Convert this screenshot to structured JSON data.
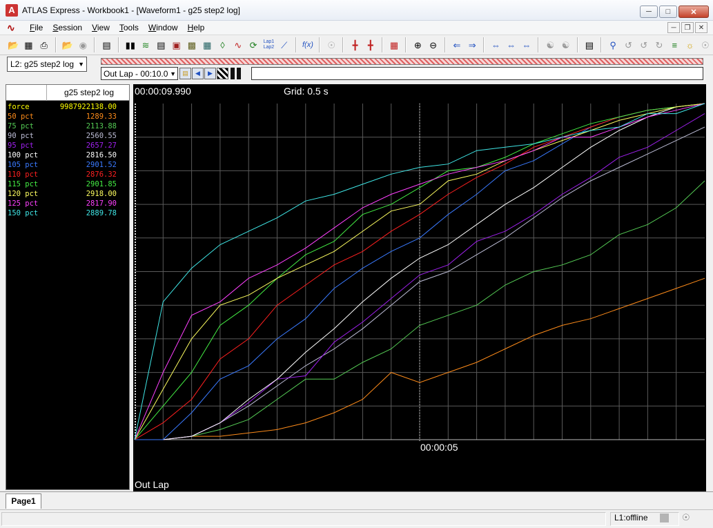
{
  "window": {
    "title": "ATLAS Express - Workbook1 - [Waveform1 - g25 step2 log]",
    "logo_letter": "A"
  },
  "menu": {
    "items": [
      "File",
      "Session",
      "View",
      "Tools",
      "Window",
      "Help"
    ]
  },
  "toolbar": {
    "lap_label": "Lap1 Lap2",
    "fx_label": "f(x)"
  },
  "session": {
    "selected": "L2: g25 step2 log"
  },
  "lap": {
    "selected": "Out Lap - 00:10.0"
  },
  "params": {
    "header": "g25 step2 log",
    "rows": [
      {
        "name": "force",
        "value": "9987922138.00",
        "color": "#ffff00"
      },
      {
        "name": "50 pct",
        "value": "1289.33",
        "color": "#ff8c1a"
      },
      {
        "name": "75 pct",
        "value": "2113.88",
        "color": "#55cc55"
      },
      {
        "name": "90 pct",
        "value": "2560.55",
        "color": "#bdbdd6"
      },
      {
        "name": "95 pct",
        "value": "2657.27",
        "color": "#a020f0"
      },
      {
        "name": "100 pct",
        "value": "2816.50",
        "color": "#ffffff"
      },
      {
        "name": "105 pct",
        "value": "2901.52",
        "color": "#3a7aff"
      },
      {
        "name": "110 pct",
        "value": "2876.32",
        "color": "#ff2020"
      },
      {
        "name": "115 pct",
        "value": "2901.85",
        "color": "#44ee44"
      },
      {
        "name": "120 pct",
        "value": "2918.00",
        "color": "#ffff60"
      },
      {
        "name": "125 pct",
        "value": "2817.90",
        "color": "#ff40ff"
      },
      {
        "name": "150 pct",
        "value": "2889.78",
        "color": "#40e8e8"
      }
    ]
  },
  "waveform": {
    "time": "00:00:09.990",
    "grid": "Grid: 0.5 s",
    "cursor_time": "00:00:05",
    "lap_name": "Out Lap"
  },
  "chart_data": {
    "type": "line",
    "xlim": [
      0,
      10
    ],
    "ylim": [
      0,
      1
    ],
    "x": [
      0,
      0.5,
      1,
      1.5,
      2,
      2.5,
      3,
      3.5,
      4,
      4.5,
      5,
      5.5,
      6,
      6.5,
      7,
      7.5,
      8,
      8.5,
      9,
      9.5,
      10
    ],
    "series": [
      {
        "name": "50 pct",
        "color": "#ff8c1a",
        "values": [
          0,
          0,
          0.01,
          0.01,
          0.02,
          0.03,
          0.05,
          0.08,
          0.12,
          0.2,
          0.17,
          0.2,
          0.23,
          0.27,
          0.31,
          0.34,
          0.36,
          0.39,
          0.42,
          0.45,
          0.48
        ]
      },
      {
        "name": "75 pct",
        "color": "#55cc55",
        "values": [
          0,
          0,
          0.01,
          0.03,
          0.06,
          0.12,
          0.18,
          0.18,
          0.23,
          0.27,
          0.34,
          0.37,
          0.4,
          0.46,
          0.5,
          0.52,
          0.55,
          0.61,
          0.64,
          0.69,
          0.77
        ]
      },
      {
        "name": "90 pct",
        "color": "#bdbdd6",
        "values": [
          0,
          0,
          0.01,
          0.05,
          0.1,
          0.16,
          0.22,
          0.27,
          0.33,
          0.4,
          0.47,
          0.5,
          0.55,
          0.6,
          0.66,
          0.72,
          0.77,
          0.81,
          0.85,
          0.89,
          0.93
        ]
      },
      {
        "name": "95 pct",
        "color": "#a020f0",
        "values": [
          0,
          0,
          0.01,
          0.05,
          0.11,
          0.18,
          0.19,
          0.29,
          0.35,
          0.42,
          0.49,
          0.52,
          0.59,
          0.62,
          0.67,
          0.73,
          0.78,
          0.84,
          0.87,
          0.92,
          0.97
        ]
      },
      {
        "name": "100 pct",
        "color": "#ffffff",
        "values": [
          0,
          0,
          0.01,
          0.05,
          0.12,
          0.18,
          0.26,
          0.33,
          0.41,
          0.48,
          0.54,
          0.58,
          0.64,
          0.7,
          0.75,
          0.81,
          0.87,
          0.92,
          0.96,
          0.99,
          1.0
        ]
      },
      {
        "name": "105 pct",
        "color": "#3a7aff",
        "values": [
          0,
          0,
          0.08,
          0.18,
          0.22,
          0.3,
          0.36,
          0.45,
          0.51,
          0.56,
          0.6,
          0.67,
          0.73,
          0.8,
          0.83,
          0.88,
          0.93,
          0.96,
          0.98,
          0.99,
          1.0
        ]
      },
      {
        "name": "110 pct",
        "color": "#ff2020",
        "values": [
          0,
          0.05,
          0.12,
          0.24,
          0.3,
          0.4,
          0.46,
          0.52,
          0.56,
          0.62,
          0.67,
          0.73,
          0.78,
          0.82,
          0.87,
          0.9,
          0.93,
          0.96,
          0.98,
          0.99,
          1.0
        ]
      },
      {
        "name": "115 pct",
        "color": "#44ee44",
        "values": [
          0,
          0.1,
          0.2,
          0.34,
          0.4,
          0.48,
          0.55,
          0.59,
          0.67,
          0.7,
          0.75,
          0.8,
          0.81,
          0.84,
          0.88,
          0.91,
          0.94,
          0.96,
          0.98,
          0.99,
          1.0
        ]
      },
      {
        "name": "120 pct",
        "color": "#ffff60",
        "values": [
          0,
          0.15,
          0.3,
          0.4,
          0.43,
          0.48,
          0.52,
          0.56,
          0.62,
          0.68,
          0.7,
          0.77,
          0.79,
          0.83,
          0.86,
          0.89,
          0.92,
          0.95,
          0.97,
          0.99,
          1.0
        ]
      },
      {
        "name": "125 pct",
        "color": "#ff40ff",
        "values": [
          0,
          0.2,
          0.37,
          0.41,
          0.48,
          0.52,
          0.57,
          0.63,
          0.69,
          0.73,
          0.76,
          0.79,
          0.81,
          0.83,
          0.86,
          0.9,
          0.9,
          0.93,
          0.96,
          0.98,
          1.0
        ]
      },
      {
        "name": "150 pct",
        "color": "#40e8e8",
        "values": [
          0,
          0.41,
          0.51,
          0.58,
          0.62,
          0.66,
          0.71,
          0.73,
          0.76,
          0.79,
          0.81,
          0.82,
          0.86,
          0.87,
          0.88,
          0.9,
          0.92,
          0.93,
          0.97,
          0.97,
          1.0
        ]
      }
    ]
  },
  "status": {
    "connection": "L1:offline"
  },
  "pages": {
    "active": "Page1"
  }
}
